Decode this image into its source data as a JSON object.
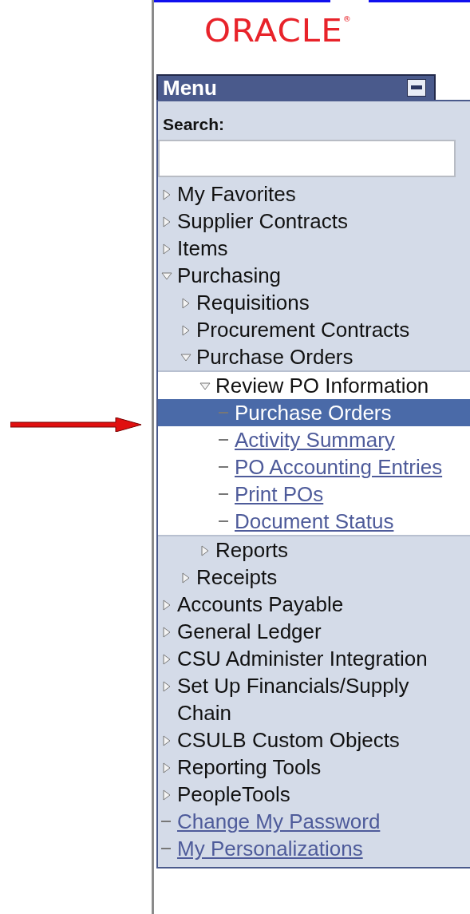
{
  "logo": {
    "text": "ORACLE$^{®}$"
  },
  "menu": {
    "title": "Menu",
    "search": {
      "label": "Search:"
    },
    "items": [
      {
        "kind": "folder",
        "label": "My Favorites",
        "expanded": false,
        "current": false
      },
      {
        "kind": "folder",
        "label": "Supplier Contracts",
        "expanded": false,
        "current": false
      },
      {
        "kind": "folder",
        "label": "Items",
        "expanded": false,
        "current": false
      },
      {
        "kind": "folder",
        "label": "Purchasing",
        "expanded": true,
        "current": false,
        "children": [
          {
            "kind": "folder",
            "label": "Requisitions",
            "expanded": false,
            "current": false
          },
          {
            "kind": "folder",
            "label": "Procurement Contracts",
            "expanded": false,
            "current": false
          },
          {
            "kind": "folder",
            "label": "Purchase Orders",
            "expanded": true,
            "current": false,
            "children": [
              {
                "kind": "folder",
                "label": "Review PO Information",
                "expanded": true,
                "current": true,
                "children": [
                  {
                    "kind": "link",
                    "label": "Purchase Orders",
                    "selected": true
                  },
                  {
                    "kind": "link",
                    "label": "Activity Summary",
                    "selected": false
                  },
                  {
                    "kind": "link",
                    "label": "PO Accounting Entries",
                    "selected": false
                  },
                  {
                    "kind": "link",
                    "label": "Print POs",
                    "selected": false
                  },
                  {
                    "kind": "link",
                    "label": "Document Status",
                    "selected": false
                  }
                ]
              },
              {
                "kind": "folder",
                "label": "Reports",
                "expanded": false,
                "current": false
              }
            ]
          },
          {
            "kind": "folder",
            "label": "Receipts",
            "expanded": false,
            "current": false
          }
        ]
      },
      {
        "kind": "folder",
        "label": "Accounts Payable",
        "expanded": false,
        "current": false
      },
      {
        "kind": "folder",
        "label": "General Ledger",
        "expanded": false,
        "current": false
      },
      {
        "kind": "folder",
        "label": "CSU Administer Integration",
        "expanded": false,
        "current": false
      },
      {
        "kind": "folder",
        "label": "Set Up Financials/Supply Chain",
        "expanded": false,
        "current": false
      },
      {
        "kind": "folder",
        "label": "CSULB Custom Objects",
        "expanded": false,
        "current": false
      },
      {
        "kind": "folder",
        "label": "Reporting Tools",
        "expanded": false,
        "current": false
      },
      {
        "kind": "folder",
        "label": "PeopleTools",
        "expanded": false,
        "current": false
      },
      {
        "kind": "link",
        "label": "Change My Password",
        "selected": false
      },
      {
        "kind": "link",
        "label": "My Personalizations",
        "selected": false
      }
    ]
  }
}
